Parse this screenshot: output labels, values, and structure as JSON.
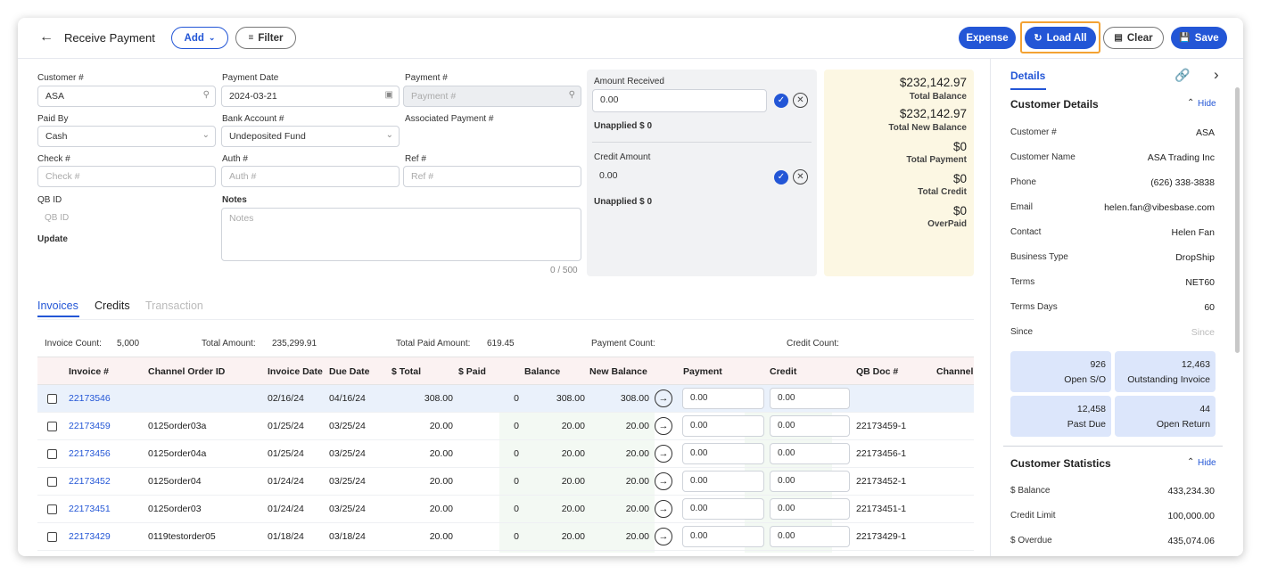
{
  "header": {
    "back_icon": "arrow-left-icon",
    "title": "Receive Payment",
    "add_label": "Add",
    "filter_label": "Filter",
    "expense_label": "Expense",
    "load_all_label": "Load All",
    "clear_label": "Clear",
    "save_label": "Save",
    "accent": "#2356d6",
    "highlight": "#f3a233"
  },
  "form": {
    "customer_label": "Customer #",
    "customer_value": "ASA",
    "payment_date_label": "Payment Date",
    "payment_date_value": "2024-03-21",
    "payment_no_label": "Payment #",
    "payment_no_placeholder": "Payment #",
    "paid_by_label": "Paid By",
    "paid_by_value": "Cash",
    "bank_label": "Bank Account #",
    "bank_value": "Undeposited Fund",
    "assoc_label": "Associated Payment #",
    "check_label": "Check #",
    "check_placeholder": "Check #",
    "auth_label": "Auth #",
    "auth_placeholder": "Auth #",
    "ref_label": "Ref #",
    "ref_placeholder": "Ref #",
    "qb_label": "QB ID",
    "qb_placeholder": "QB ID",
    "notes_label": "Notes",
    "notes_placeholder": "Notes",
    "update_label": "Update",
    "notes_counter": "0 / 500"
  },
  "amount": {
    "received_label": "Amount Received",
    "received_value": "0.00",
    "unapplied1": "Unapplied $ 0",
    "credit_label": "Credit Amount",
    "credit_value": "0.00",
    "unapplied2": "Unapplied $ 0"
  },
  "totals": [
    {
      "amount": "$232,142.97",
      "label": "Total Balance"
    },
    {
      "amount": "$232,142.97",
      "label": "Total New Balance"
    },
    {
      "amount": "$0",
      "label": "Total Payment"
    },
    {
      "amount": "$0",
      "label": "Total Credit"
    },
    {
      "amount": "$0",
      "label": "OverPaid"
    }
  ],
  "tabs": [
    "Invoices",
    "Credits",
    "Transaction"
  ],
  "summary": {
    "invoice_count_label": "Invoice Count:",
    "invoice_count": "5,000",
    "total_amount_label": "Total Amount:",
    "total_amount": "235,299.91",
    "total_paid_label": "Total Paid Amount:",
    "total_paid": "619.45",
    "payment_count_label": "Payment Count:",
    "credit_count_label": "Credit Count:"
  },
  "table": {
    "columns": [
      "Invoice #",
      "Channel Order ID",
      "Invoice Date",
      "Due Date",
      "$ Total",
      "$ Paid",
      "Balance",
      "New Balance",
      "Payment",
      "Credit",
      "QB Doc #",
      "Channel"
    ],
    "rows": [
      {
        "invoice": "22173546",
        "order": "",
        "inv_date": "02/16/24",
        "due": "04/16/24",
        "total": "308.00",
        "paid": "0",
        "balance": "308.00",
        "new_balance": "308.00",
        "payment": "0.00",
        "credit": "0.00",
        "qb": ""
      },
      {
        "invoice": "22173459",
        "order": "0125order03a",
        "inv_date": "01/25/24",
        "due": "03/25/24",
        "total": "20.00",
        "paid": "0",
        "balance": "20.00",
        "new_balance": "20.00",
        "payment": "0.00",
        "credit": "0.00",
        "qb": "22173459-1"
      },
      {
        "invoice": "22173456",
        "order": "0125order04a",
        "inv_date": "01/25/24",
        "due": "03/25/24",
        "total": "20.00",
        "paid": "0",
        "balance": "20.00",
        "new_balance": "20.00",
        "payment": "0.00",
        "credit": "0.00",
        "qb": "22173456-1"
      },
      {
        "invoice": "22173452",
        "order": "0125order04",
        "inv_date": "01/24/24",
        "due": "03/25/24",
        "total": "20.00",
        "paid": "0",
        "balance": "20.00",
        "new_balance": "20.00",
        "payment": "0.00",
        "credit": "0.00",
        "qb": "22173452-1"
      },
      {
        "invoice": "22173451",
        "order": "0125order03",
        "inv_date": "01/24/24",
        "due": "03/25/24",
        "total": "20.00",
        "paid": "0",
        "balance": "20.00",
        "new_balance": "20.00",
        "payment": "0.00",
        "credit": "0.00",
        "qb": "22173451-1"
      },
      {
        "invoice": "22173429",
        "order": "0119testorder05",
        "inv_date": "01/18/24",
        "due": "03/18/24",
        "total": "20.00",
        "paid": "0",
        "balance": "20.00",
        "new_balance": "20.00",
        "payment": "0.00",
        "credit": "0.00",
        "qb": "22173429-1"
      }
    ]
  },
  "details": {
    "tab_label": "Details",
    "customer_details_title": "Customer Details",
    "hide_label": "Hide",
    "fields": [
      {
        "label": "Customer #",
        "value": "ASA"
      },
      {
        "label": "Customer Name",
        "value": "ASA Trading Inc"
      },
      {
        "label": "Phone",
        "value": "(626) 338-3838"
      },
      {
        "label": "Email",
        "value": "helen.fan@vibesbase.com"
      },
      {
        "label": "Contact",
        "value": "Helen Fan"
      },
      {
        "label": "Business Type",
        "value": "DropShip"
      },
      {
        "label": "Terms",
        "value": "NET60"
      },
      {
        "label": "Terms Days",
        "value": "60"
      },
      {
        "label": "Since",
        "value": "Since"
      }
    ],
    "cards": [
      {
        "num": "926",
        "title": "Open S/O"
      },
      {
        "num": "12,463",
        "title": "Outstanding Invoice"
      },
      {
        "num": "12,458",
        "title": "Past Due"
      },
      {
        "num": "44",
        "title": "Open Return"
      }
    ],
    "stats_title": "Customer Statistics",
    "stats": [
      {
        "label": "$ Balance",
        "value": "433,234.30"
      },
      {
        "label": "Credit Limit",
        "value": "100,000.00"
      },
      {
        "label": "$ Overdue",
        "value": "435,074.06"
      }
    ]
  }
}
